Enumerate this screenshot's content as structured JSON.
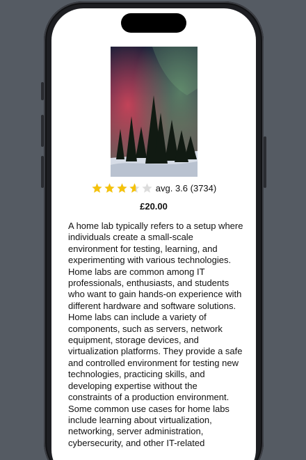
{
  "product": {
    "image_alt": "Northern lights over a snowy pine forest",
    "rating": 3.6,
    "rating_max": 5,
    "rating_label": "avg. 3.6 (3734)",
    "price": "£20.00",
    "description": "A home lab typically refers to a setup where individuals create a small-scale environment for testing, learning, and experimenting with various technologies. Home labs are common among IT professionals, enthusiasts, and students who want to gain hands-on experience with different hardware and software solutions. Home labs can include a variety of components, such as servers, network equipment, storage devices, and virtualization platforms. They provide a safe and controlled environment for testing new technologies, practicing skills, and developing expertise without the constraints of a production environment. Some common use cases for home labs include learning about virtualization, networking, server administration, cybersecurity, and other IT-related"
  },
  "colors": {
    "star_filled": "#f5c20b",
    "star_empty": "#dcdcdc",
    "backdrop": "#555b63"
  }
}
